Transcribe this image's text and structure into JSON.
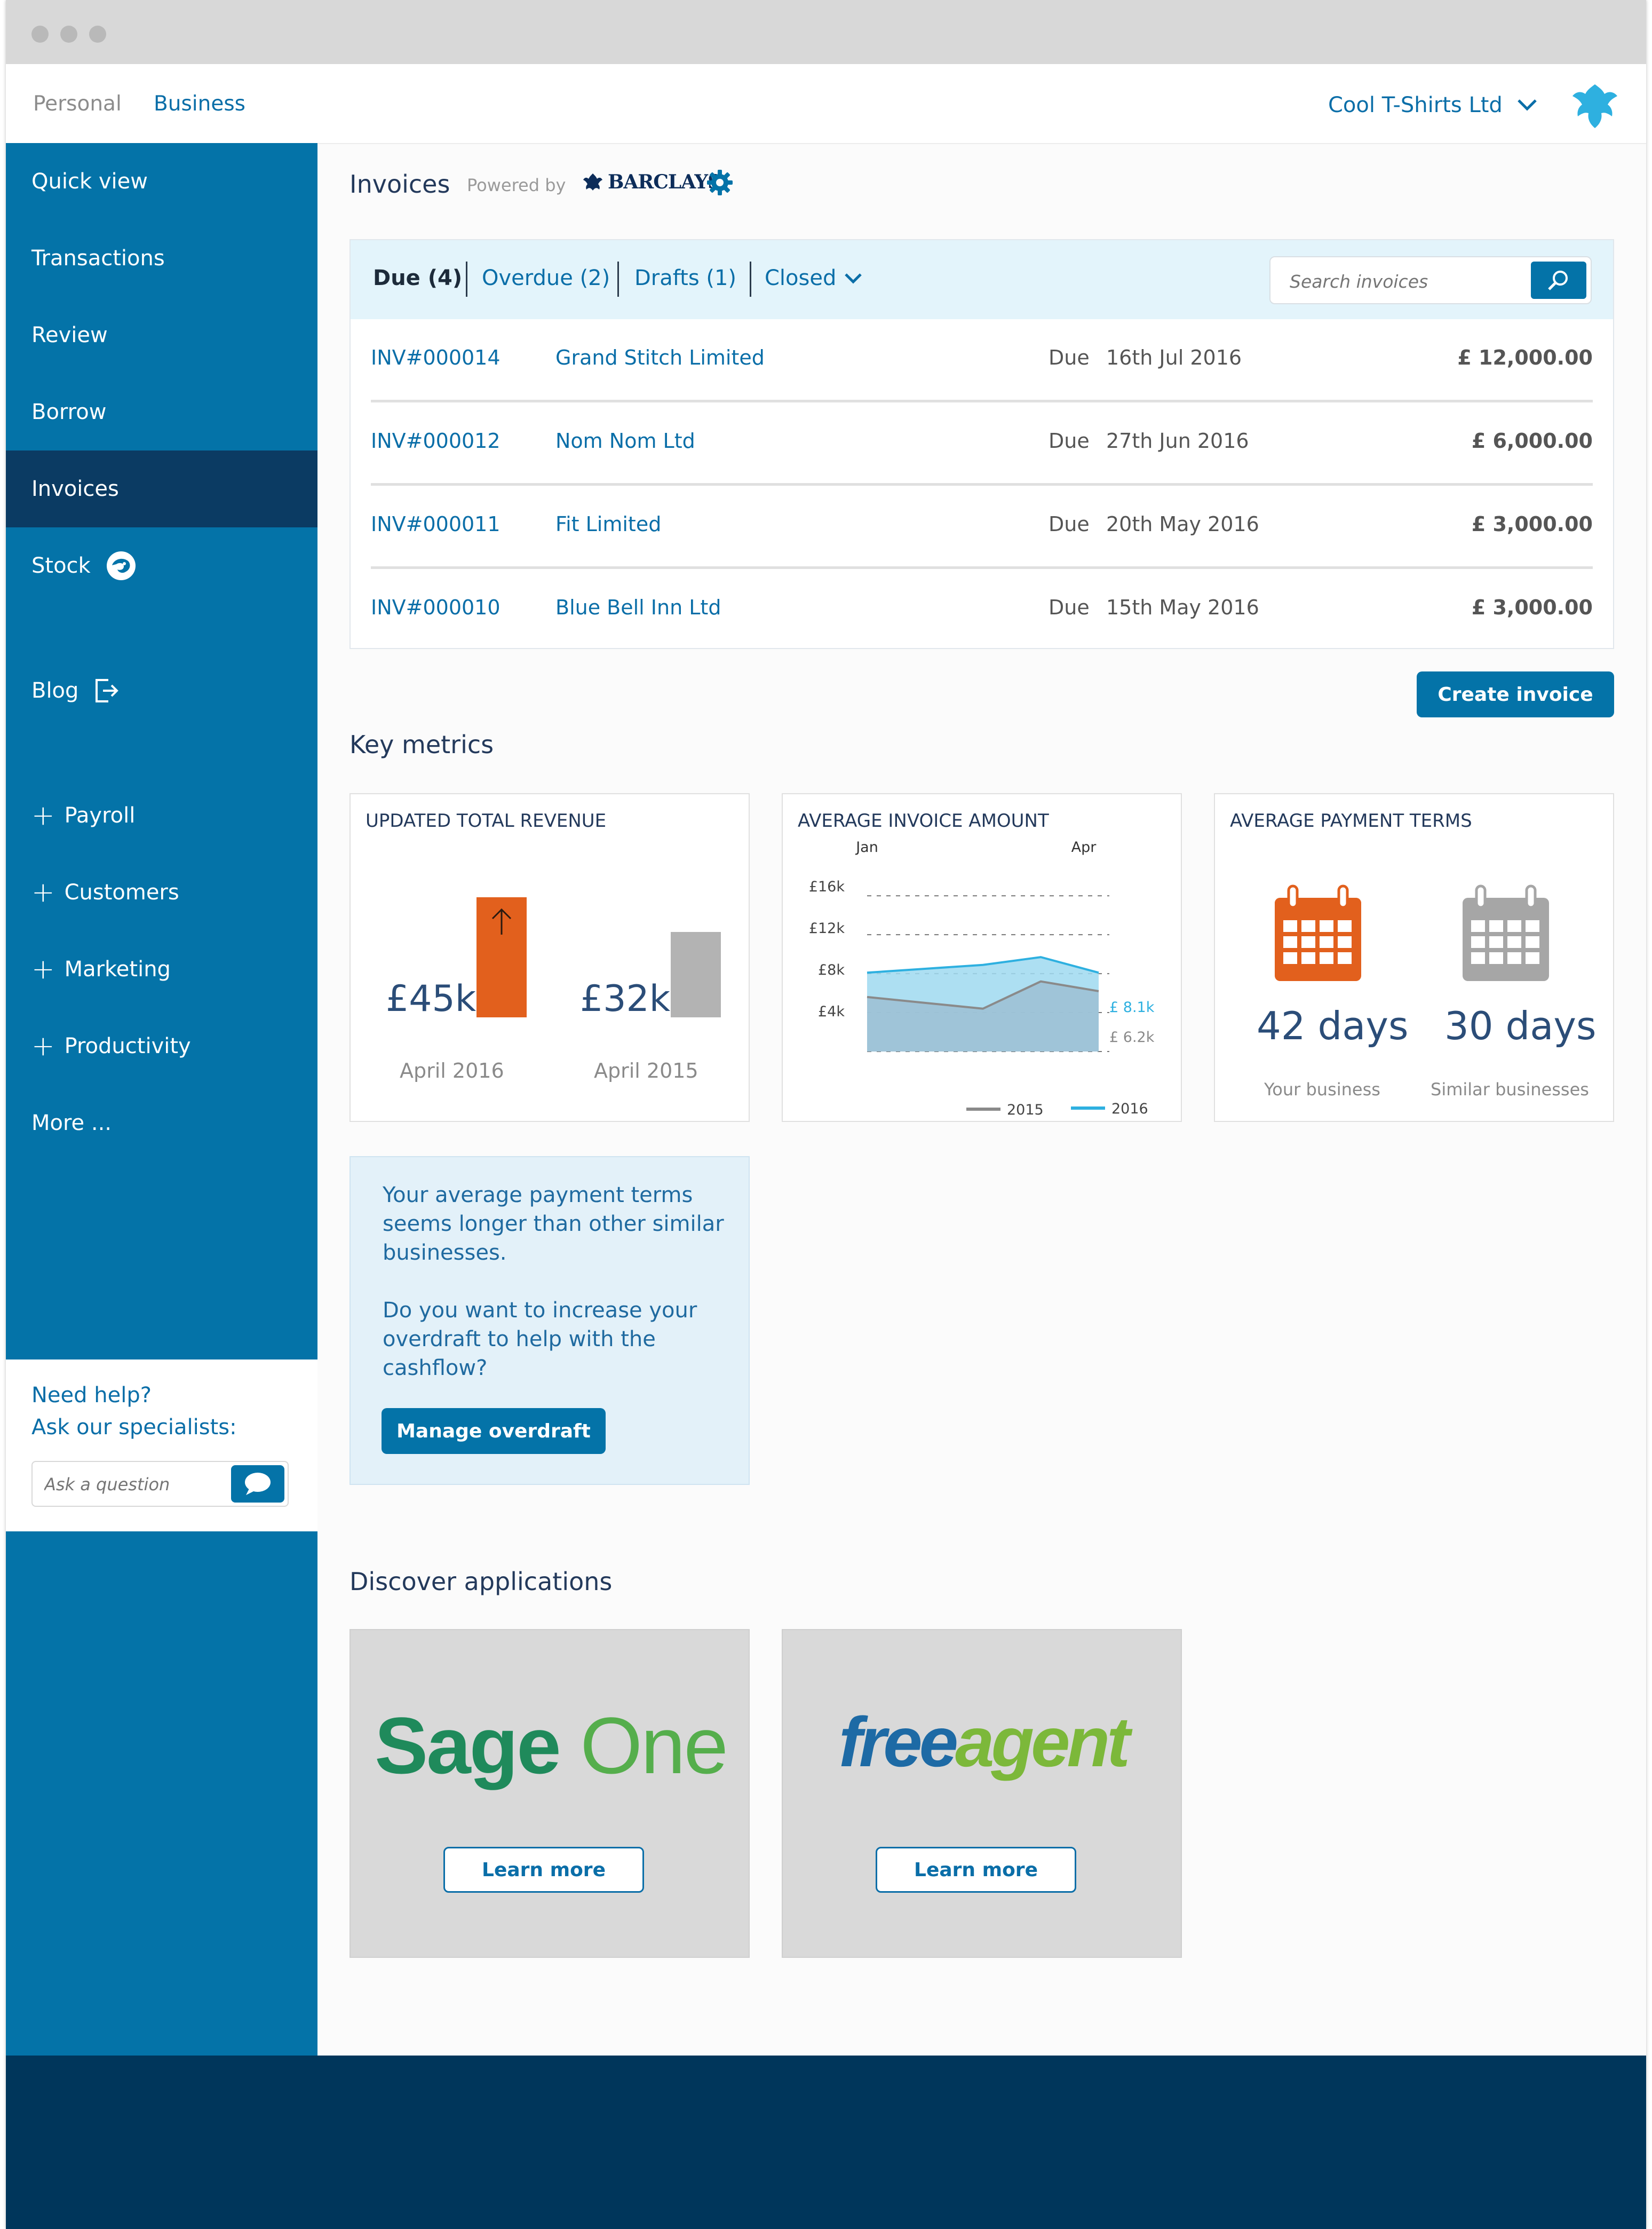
{
  "topnav": {
    "personal": "Personal",
    "business": "Business",
    "company": "Cool T-Shirts Ltd"
  },
  "sidebar": {
    "items": [
      {
        "label": "Quick view"
      },
      {
        "label": "Transactions"
      },
      {
        "label": "Review"
      },
      {
        "label": "Borrow"
      },
      {
        "label": "Invoices",
        "active": true
      },
      {
        "label": "Stock"
      },
      {
        "label": "Blog"
      }
    ],
    "expandables": [
      {
        "label": "Payroll"
      },
      {
        "label": "Customers"
      },
      {
        "label": "Marketing"
      },
      {
        "label": "Productivity"
      }
    ],
    "more": "More ...",
    "help": {
      "line1": "Need help?",
      "line2": "Ask our specialists:",
      "placeholder": "Ask a question"
    }
  },
  "invoices": {
    "title": "Invoices",
    "powered_by": "Powered by",
    "brand": "BARCLAYS",
    "tabs": {
      "due": "Due (4)",
      "overdue": "Overdue (2)",
      "drafts": "Drafts (1)",
      "closed": "Closed"
    },
    "search_placeholder": "Search invoices",
    "rows": [
      {
        "id": "INV#000014",
        "customer": "Grand Stitch Limited",
        "due_label": "Due",
        "date": "16th Jul 2016",
        "amount": "£ 12,000.00"
      },
      {
        "id": "INV#000012",
        "customer": "Nom Nom Ltd",
        "due_label": "Due",
        "date": "27th Jun 2016",
        "amount": "£ 6,000.00"
      },
      {
        "id": "INV#000011",
        "customer": "Fit Limited",
        "due_label": "Due",
        "date": "20th May 2016",
        "amount": "£ 3,000.00"
      },
      {
        "id": "INV#000010",
        "customer": "Blue Bell Inn Ltd",
        "due_label": "Due",
        "date": "15th May 2016",
        "amount": "£ 3,000.00"
      }
    ],
    "create_button": "Create invoice"
  },
  "metrics": {
    "title": "Key metrics",
    "revenue": {
      "title": "UPDATED TOTAL REVENUE",
      "current_value": "£45k",
      "current_label": "April 2016",
      "previous_value": "£32k",
      "previous_label": "April 2015",
      "current_k": 45,
      "previous_k": 32
    },
    "avg_invoice": {
      "title": "AVERAGE INVOICE AMOUNT",
      "x_labels": [
        "Jan",
        "Apr"
      ],
      "y_labels": [
        "£16k",
        "£12k",
        "£8k",
        "£4k"
      ],
      "legend_2015": "2015",
      "legend_2016": "2016",
      "end_label_2016": "£ 8.1k",
      "end_label_2015": "£ 6.2k"
    },
    "payment_terms": {
      "title": "AVERAGE PAYMENT TERMS",
      "your_days": "42 days",
      "your_label": "Your business",
      "similar_days": "30 days",
      "similar_label": "Similar businesses"
    }
  },
  "chart_data": {
    "type": "area",
    "title": "AVERAGE INVOICE AMOUNT",
    "x": [
      0,
      1,
      2,
      3,
      4
    ],
    "x_tick_labels": [
      "Jan",
      "Apr"
    ],
    "y_tick_labels": [
      "£16k",
      "£12k",
      "£8k",
      "£4k"
    ],
    "ylim": [
      0,
      17
    ],
    "grid": true,
    "legend": "bottom-right",
    "series": [
      {
        "name": "2015",
        "values": [
          5.6,
          5.0,
          4.4,
          7.2,
          6.2
        ],
        "color": "#9a9a9a"
      },
      {
        "name": "2016",
        "values": [
          8.1,
          8.5,
          8.9,
          9.7,
          8.1
        ],
        "color": "#2eb0e0"
      }
    ]
  },
  "advice": {
    "text1": "Your average payment terms seems longer than other similar businesses.",
    "text2": "Do you want to increase your overdraft to help with the cashflow?",
    "button": "Manage overdraft"
  },
  "apps": {
    "title": "Discover applications",
    "items": [
      {
        "logo_a": "Sage",
        "logo_b": "One",
        "button": "Learn more"
      },
      {
        "logo_a": "free",
        "logo_b": "agent",
        "button": "Learn more"
      }
    ]
  },
  "colors": {
    "primary": "#0473a8",
    "sidebar_active": "#0b3b63",
    "footer": "#00365b",
    "accent_orange": "#e2601d",
    "sage_green": "#1f9a5b",
    "freeagent_blue": "#1d6aa5",
    "freeagent_green": "#7cb83a"
  }
}
